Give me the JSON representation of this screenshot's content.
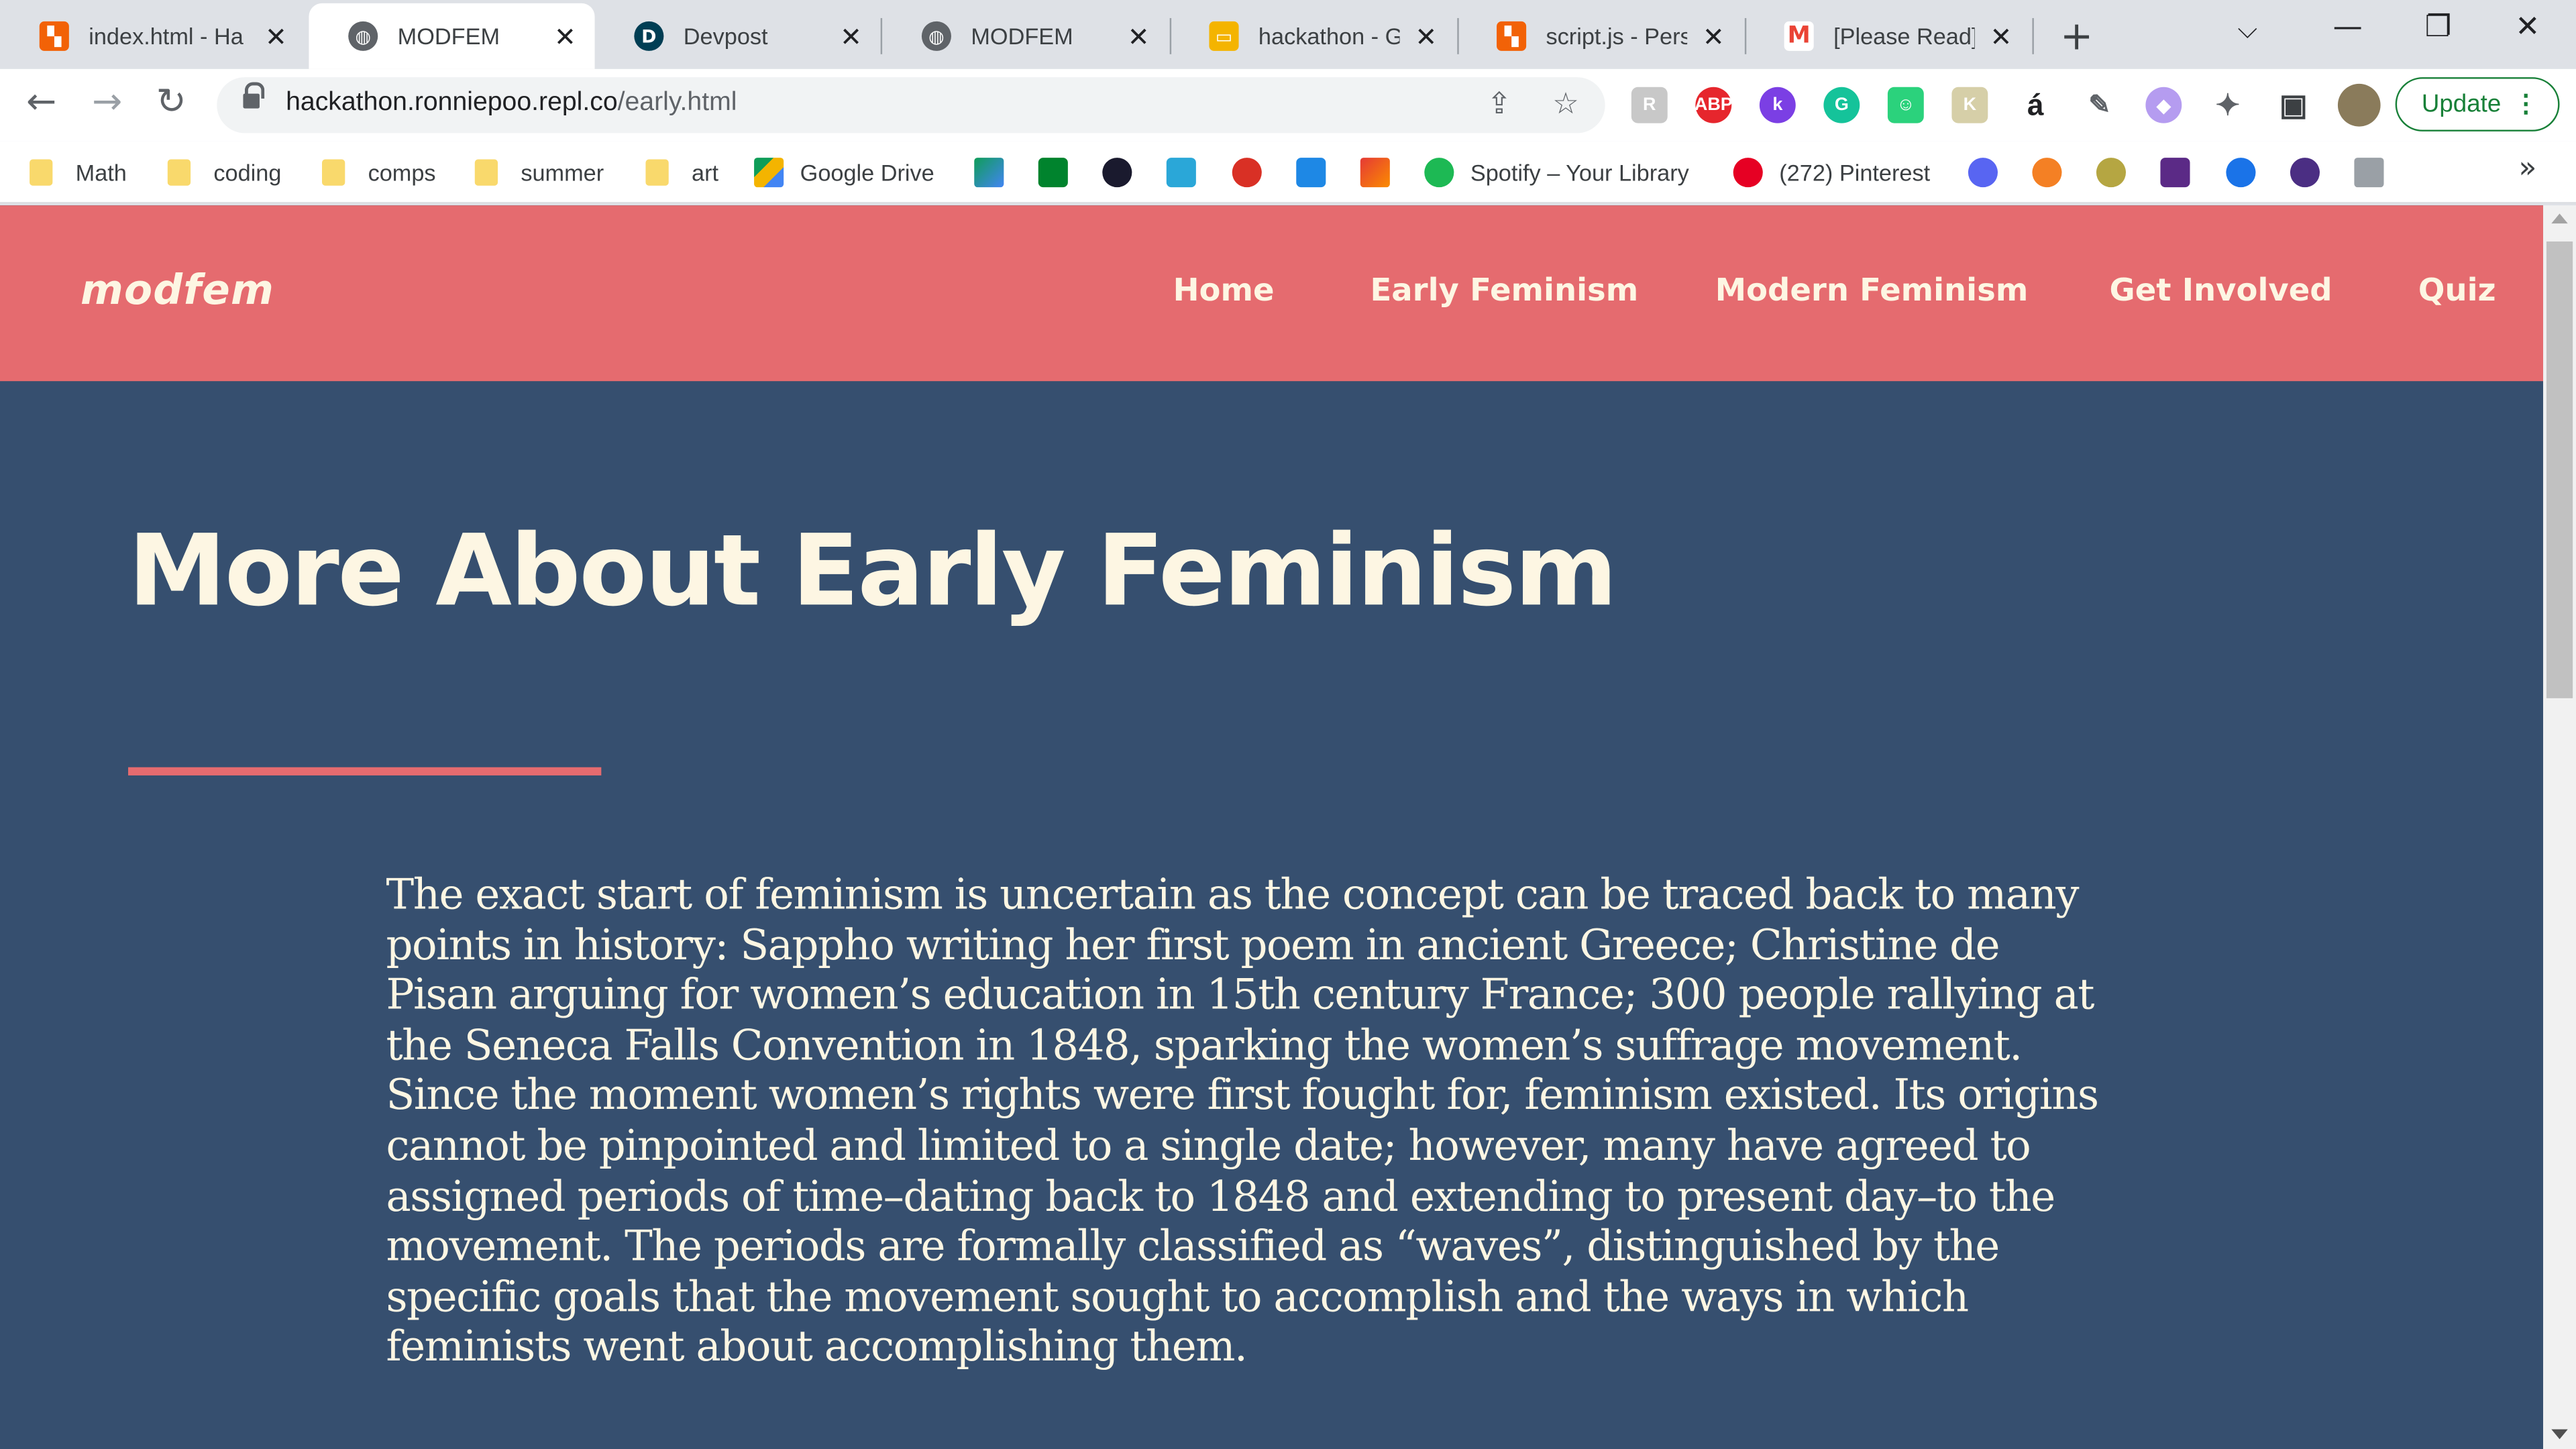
{
  "browser": {
    "tabs": [
      {
        "title": "index.html - Ha",
        "favicon": "replit-icon",
        "favicon_color": "#f26207",
        "active": false
      },
      {
        "title": "MODFEM",
        "favicon": "globe-icon",
        "favicon_color": "#5f6368",
        "active": true
      },
      {
        "title": "Devpost",
        "favicon": "devpost-icon",
        "favicon_color": "#003e54",
        "favicon_text": "D",
        "active": false
      },
      {
        "title": "MODFEM",
        "favicon": "globe-icon",
        "favicon_color": "#5f6368",
        "active": false
      },
      {
        "title": "hackathon - Go",
        "favicon": "slides-icon",
        "favicon_color": "#f4b400",
        "active": false
      },
      {
        "title": "script.js - Perso",
        "favicon": "replit-icon",
        "favicon_color": "#f26207",
        "active": false
      },
      {
        "title": "[Please Read] T",
        "favicon": "gmail-icon",
        "favicon_color": "#ea4335",
        "favicon_text": "M",
        "active": false
      }
    ],
    "new_tab_label": "+",
    "address": {
      "host": "hackathon.ronniepoo.repl.co",
      "path": "/early.html"
    },
    "update_label": "Update",
    "bookmarks": [
      {
        "label": "Math",
        "type": "folder"
      },
      {
        "label": "coding",
        "type": "folder"
      },
      {
        "label": "comps",
        "type": "folder"
      },
      {
        "label": "summer",
        "type": "folder"
      },
      {
        "label": "art",
        "type": "folder"
      },
      {
        "label": "Google Drive",
        "type": "link",
        "icon": "google-drive-icon"
      },
      {
        "label": "Spotify – Your Library",
        "type": "link",
        "icon": "spotify-icon"
      },
      {
        "label": "(272) Pinterest",
        "type": "link",
        "icon": "pinterest-icon"
      }
    ]
  },
  "site": {
    "logo": "modfem",
    "nav": [
      "Home",
      "Early Feminism",
      "Modern Feminism",
      "Get Involved",
      "Quiz"
    ],
    "heading": "More About Early Feminism",
    "paragraph_lines": [
      "The exact start of feminism is uncertain as the concept can be traced back to many",
      "points in history: Sappho writing her first poem in ancient Greece; Christine de",
      "Pisan arguing for women’s education in 15th century France; 300 people rallying at",
      "the Seneca Falls Convention in 1848, sparking the women’s suffrage movement.",
      "Since the moment women’s rights were first fought for, feminism existed. Its origins",
      "cannot be pinpointed and limited to a single date; however, many have agreed to",
      "assigned periods of time–dating back to 1848 and extending to present day–to the",
      "movement. The periods are formally classified as “waves”, distinguished by the",
      "specific goals that the movement sought to accomplish and the ways in which",
      "feminists went about accomplishing them."
    ]
  },
  "colors": {
    "navbar": "#e56b6f",
    "page_background": "#364f6f",
    "text": "#fdf6e3",
    "accent_rule": "#e56b6f"
  }
}
